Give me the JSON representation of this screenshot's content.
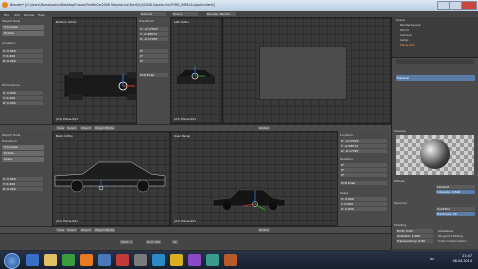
{
  "window": {
    "title": "Blender* [C:\\Users\\Romanovicz\\Desktop\\Fusion\\ProfileCar2006 Steyear.inc\\Ford\\Cyl\\2008-Sayear.inc\\FORD_IMPALA.Applic.blend]"
  },
  "menu": {
    "file": "File",
    "add": "Add",
    "render": "Render",
    "help": "Help",
    "layout": "Default",
    "scene": "Scene",
    "engine": "Blender Render"
  },
  "viewports": {
    "top_left": {
      "name": "Bottom Ortho",
      "footer": "(21) Plane.001"
    },
    "top_mid": {
      "name": "Left Ortho",
      "footer": "(21) Plane.001"
    },
    "bottom_left": {
      "name": "Back Ortho",
      "footer": "(21) Plane.001"
    },
    "bottom_mid": {
      "name": "User Persp",
      "footer": "(21) Plane.001"
    }
  },
  "toolshelf": {
    "object_tools": "Object Tools",
    "transform": "Transform",
    "translate": "Translate",
    "rotate": "Rotate",
    "scale": "Scale",
    "location_label": "Location:",
    "loc_x": "X: 0.000",
    "loc_y": "Y: 0.000",
    "loc_z": "Z: 0.000",
    "dimensions": "Dimensions:",
    "dim_x": "X: 0.000",
    "dim_y": "Y: 0.000",
    "dim_z": "Z: 0.000"
  },
  "npanel": {
    "transform": "Transform",
    "location": "Location:",
    "x": "X: -4.17923",
    "y": "Y: -0.28574",
    "z": "Z: -0.17087",
    "rotation": "Rotation:",
    "rx": "0°",
    "ry": "0°",
    "rz": "0°",
    "mode": "XYZ Euler",
    "scale": "Scale:",
    "sx": "X: 0.000",
    "sy": "Y: 0.000",
    "sz": "Z: 0.000"
  },
  "headers": {
    "view": "View",
    "select": "Select",
    "object": "Object",
    "mode": "Object Mode",
    "global": "Global"
  },
  "outliner": {
    "rows": [
      "Scene",
      "RenderLayers",
      "World",
      "Camera",
      "Lamp",
      "Plane.001"
    ]
  },
  "properties": {
    "material": "Material",
    "preview": "Preview",
    "diffuse": "Diffuse",
    "diffuse_shader": "Lambert",
    "intensity": "Intensity: 0.800",
    "specular": "Specular",
    "spec_shader": "CookTorr",
    "hardness": "Hardness: 50",
    "shading": "Shading",
    "emit": "Emit: 0.00",
    "ambient": "Ambient: 1.000",
    "translucency": "Translucency: 0.00",
    "shadeless": "Shadeless",
    "tangent": "Tangent Shading",
    "cubic": "Cubic Interpolation"
  },
  "timeline": {
    "start": "Start: 1",
    "end": "End: 250",
    "frame": "21"
  },
  "taskbar": {
    "time": "21:47",
    "date": "06.04.2014",
    "lang": "RU"
  },
  "colors": {
    "accent": "#e8831f",
    "select": "#5a7ca8",
    "bg": "#393939"
  }
}
